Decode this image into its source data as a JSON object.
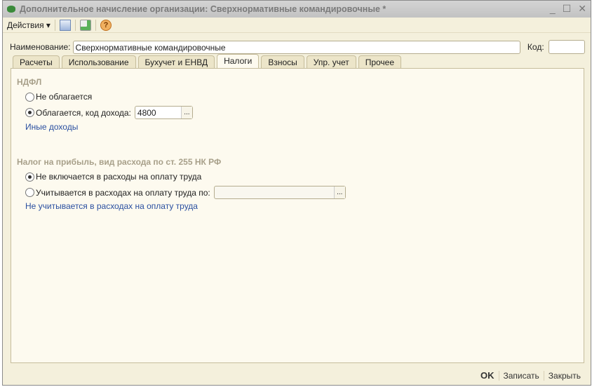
{
  "window": {
    "title": "Дополнительное начисление организации: Сверхнормативные командировочные *"
  },
  "toolbar": {
    "actions": "Действия"
  },
  "form": {
    "name_label": "Наименование:",
    "name_value": "Сверхнормативные командировочные",
    "code_label": "Код:",
    "code_value": ""
  },
  "tabs": [
    "Расчеты",
    "Использование",
    "Бухучет и ЕНВД",
    "Налоги",
    "Взносы",
    "Упр. учет",
    "Прочее"
  ],
  "ndfl": {
    "title": "НДФЛ",
    "opt1": "Не облагается",
    "opt2": "Облагается, код дохода:",
    "code": "4800",
    "link": "Иные доходы",
    "selected": 2
  },
  "profit": {
    "title": "Налог на прибыль, вид расхода по ст. 255 НК РФ",
    "opt1": "Не включается в расходы на оплату труда",
    "opt2": "Учитывается в расходах на оплату труда по:",
    "value": "",
    "link": "Не учитывается в расходах на оплату труда",
    "selected": 1
  },
  "buttons": {
    "ok": "OK",
    "save": "Записать",
    "close": "Закрыть"
  }
}
